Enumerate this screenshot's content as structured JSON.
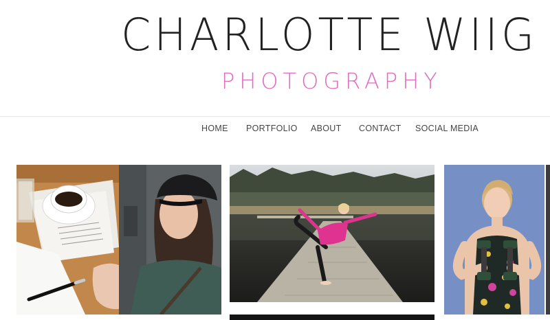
{
  "site": {
    "title": "CHARLOTTE WIIG",
    "subtitle": "PHOTOGRAPHY"
  },
  "nav": {
    "items": [
      "HOME",
      "PORTFOLIO",
      "ABOUT",
      "CONTACT",
      "SOCIAL MEDIA"
    ]
  },
  "gallery": {
    "photo1": {
      "alt": "Coffee cup on desk with documents, and woman in black cap"
    },
    "photo2": {
      "alt": "Woman in pink doing yoga pose on wooden pier by a lake"
    },
    "photo3": {
      "alt": "Woman holding green dumbbells against blue background"
    }
  },
  "colors": {
    "accent": "#e06bbf",
    "text": "#222222",
    "nav_text": "#444444"
  }
}
